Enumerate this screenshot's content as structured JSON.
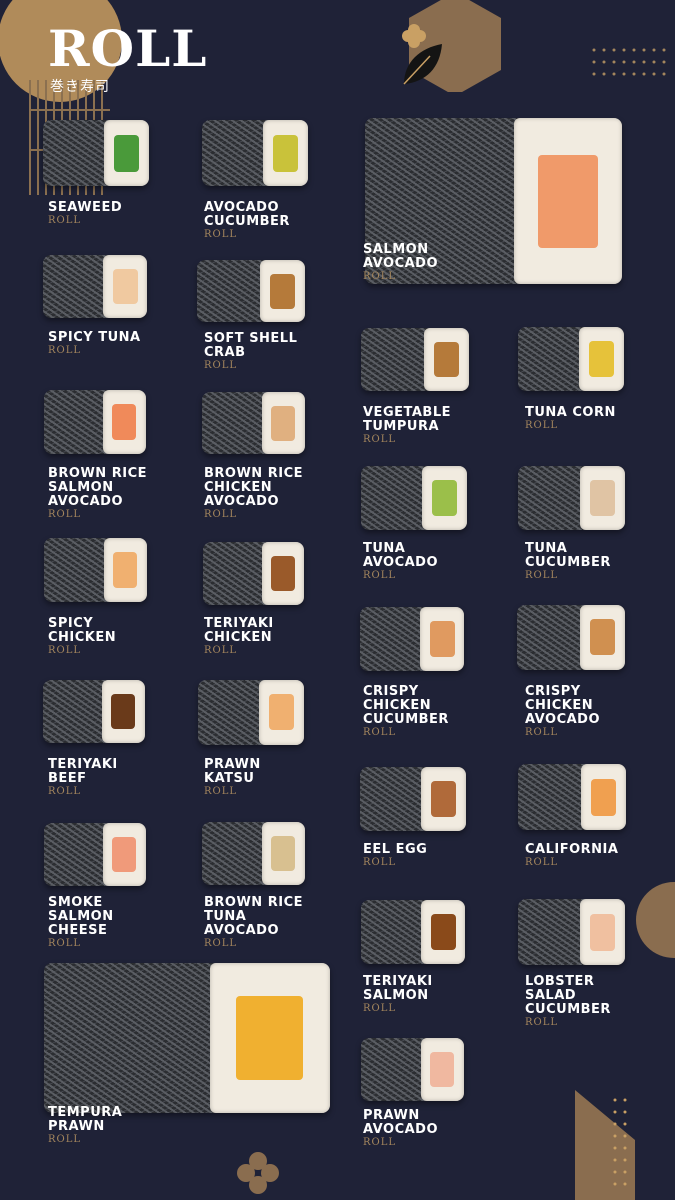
{
  "header": {
    "title": "ROLL",
    "subtitle": "巻き寿司"
  },
  "theme": {
    "background": "#1f2237",
    "accent": "#a4865d",
    "text": "#ffffff"
  },
  "icons": [
    "leaf-icon",
    "flower-icon"
  ],
  "menu": {
    "items": [
      {
        "name": "SEAWEED",
        "category": "ROLL",
        "filling": "#4a9a3a"
      },
      {
        "name": "AVOCADO\nCUCUMBER",
        "category": "ROLL",
        "filling": "#c9c23a"
      },
      {
        "name": "SALMON\nAVOCADO",
        "category": "ROLL",
        "filling": "#f09a6a"
      },
      {
        "name": "SPICY TUNA",
        "category": "ROLL",
        "filling": "#f0c9a0"
      },
      {
        "name": "SOFT SHELL\nCRAB",
        "category": "ROLL",
        "filling": "#b57a3a"
      },
      {
        "name": "VEGETABLE\nTUMPURA",
        "category": "ROLL",
        "filling": "#b57a3a"
      },
      {
        "name": "TUNA CORN",
        "category": "ROLL",
        "filling": "#e6c23a"
      },
      {
        "name": "BROWN RICE\nSALMON\nAVOCADO",
        "category": "ROLL",
        "filling": "#f08a5a"
      },
      {
        "name": "BROWN RICE\nCHICKEN\nAVOCADO",
        "category": "ROLL",
        "filling": "#e0b080"
      },
      {
        "name": "TUNA\nAVOCADO",
        "category": "ROLL",
        "filling": "#9bbf4a"
      },
      {
        "name": "TUNA\nCUCUMBER",
        "category": "ROLL",
        "filling": "#e0c4a4"
      },
      {
        "name": "SPICY\nCHICKEN",
        "category": "ROLL",
        "filling": "#f0b070"
      },
      {
        "name": "TERIYAKI\nCHICKEN",
        "category": "ROLL",
        "filling": "#9a5a2a"
      },
      {
        "name": "CRISPY\nCHICKEN\nCUCUMBER",
        "category": "ROLL",
        "filling": "#e09a60"
      },
      {
        "name": "CRISPY\nCHICKEN\nAVOCADO",
        "category": "ROLL",
        "filling": "#d09050"
      },
      {
        "name": "TERIYAKI\nBEEF",
        "category": "ROLL",
        "filling": "#6a3a1a"
      },
      {
        "name": "PRAWN\nKATSU",
        "category": "ROLL",
        "filling": "#f0b070"
      },
      {
        "name": "EEL EGG",
        "category": "ROLL",
        "filling": "#b06a3a"
      },
      {
        "name": "CALIFORNIA",
        "category": "ROLL",
        "filling": "#f0a050"
      },
      {
        "name": "SMOKE\nSALMON\nCHEESE",
        "category": "ROLL",
        "filling": "#f09a7a"
      },
      {
        "name": "BROWN RICE\nTUNA\nAVOCADO",
        "category": "ROLL",
        "filling": "#d8c090"
      },
      {
        "name": "TERIYAKI\nSALMON",
        "category": "ROLL",
        "filling": "#8a4a1a"
      },
      {
        "name": "LOBSTER\nSALAD\nCUCUMBER",
        "category": "ROLL",
        "filling": "#f0c0a0"
      },
      {
        "name": "TEMPURA\nPRAWN",
        "category": "ROLL",
        "filling": "#f0b030"
      },
      {
        "name": "PRAWN\nAVOCADO",
        "category": "ROLL",
        "filling": "#f0b8a0"
      }
    ]
  }
}
